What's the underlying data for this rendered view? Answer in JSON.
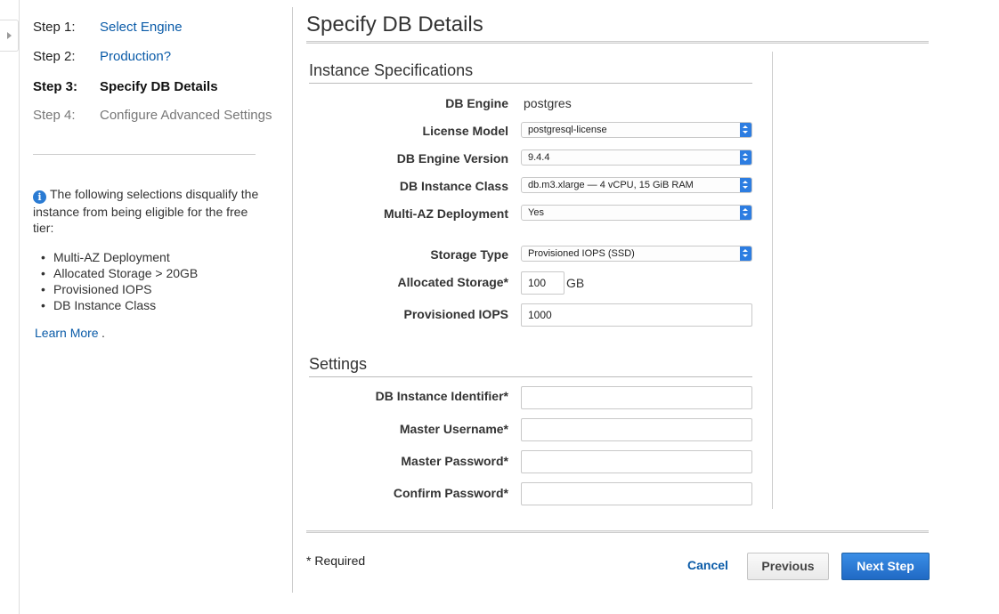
{
  "wizard": {
    "steps": [
      {
        "number": "Step 1:",
        "label": "Select Engine",
        "state": "done"
      },
      {
        "number": "Step 2:",
        "label": "Production?",
        "state": "done"
      },
      {
        "number": "Step 3:",
        "label": "Specify DB Details",
        "state": "current"
      },
      {
        "number": "Step 4:",
        "label": "Configure Advanced Settings",
        "state": "future"
      }
    ]
  },
  "info": {
    "icon": "info-icon",
    "text": "The following selections disqualify the instance from being eligible for the free tier:",
    "reasons": [
      "Multi-AZ Deployment",
      "Allocated Storage > 20GB",
      "Provisioned IOPS",
      "DB Instance Class"
    ],
    "learn_more": "Learn More",
    "learn_more_suffix": "."
  },
  "page": {
    "title": "Specify DB Details"
  },
  "instance_specs": {
    "title": "Instance Specifications",
    "db_engine": {
      "label": "DB Engine",
      "value": "postgres"
    },
    "license_model": {
      "label": "License Model",
      "value": "postgresql-license"
    },
    "engine_version": {
      "label": "DB Engine Version",
      "value": "9.4.4"
    },
    "instance_class": {
      "label": "DB Instance Class",
      "value": "db.m3.xlarge — 4 vCPU, 15 GiB RAM"
    },
    "multi_az": {
      "label": "Multi-AZ Deployment",
      "value": "Yes"
    },
    "storage_type": {
      "label": "Storage Type",
      "value": "Provisioned IOPS (SSD)"
    },
    "allocated_storage": {
      "label": "Allocated Storage*",
      "value": "100",
      "unit": "GB"
    },
    "provisioned_iops": {
      "label": "Provisioned IOPS",
      "value": "1000"
    }
  },
  "settings": {
    "title": "Settings",
    "instance_identifier": {
      "label": "DB Instance Identifier*",
      "value": ""
    },
    "master_username": {
      "label": "Master Username*",
      "value": ""
    },
    "master_password": {
      "label": "Master Password*",
      "value": ""
    },
    "confirm_password": {
      "label": "Confirm Password*",
      "value": ""
    }
  },
  "footer": {
    "required_note": "* Required",
    "cancel": "Cancel",
    "previous": "Previous",
    "next": "Next Step"
  },
  "colors": {
    "link": "#0a5ba8",
    "primary_button": "#2d7de1",
    "select_arrow": "#2d7de1"
  }
}
